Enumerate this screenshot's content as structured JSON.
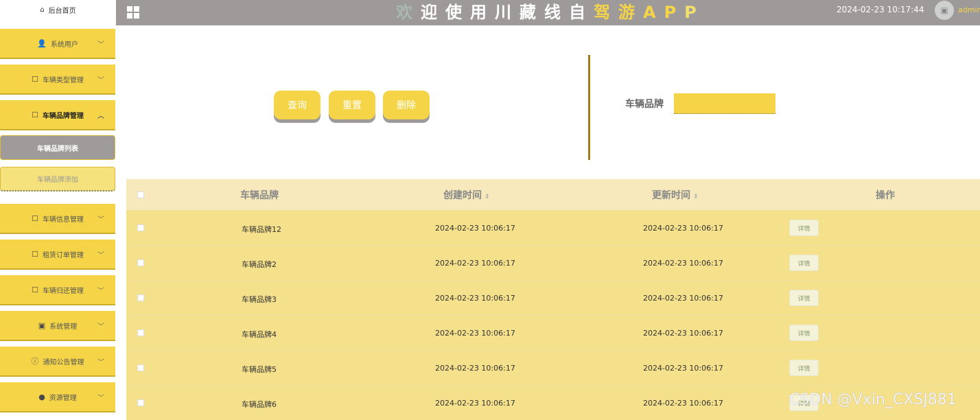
{
  "sidebar": {
    "home_label": "后台首页",
    "items": [
      {
        "label": "系统用户",
        "icon": "user-icon"
      },
      {
        "label": "车辆类型管理",
        "icon": "edit-icon"
      },
      {
        "label": "车辆品牌管理",
        "icon": "edit-icon"
      },
      {
        "label": "车辆信息管理",
        "icon": "edit-icon"
      },
      {
        "label": "租赁订单管理",
        "icon": "edit-icon"
      },
      {
        "label": "车辆归还管理",
        "icon": "edit-icon"
      },
      {
        "label": "系统管理",
        "icon": "image-icon"
      },
      {
        "label": "通知公告管理",
        "icon": "info-icon"
      },
      {
        "label": "资源管理",
        "icon": "location-icon"
      }
    ],
    "sub_items": [
      {
        "label": "车辆品牌列表"
      },
      {
        "label": "车辆品牌添加"
      }
    ]
  },
  "header": {
    "title_chars": [
      "欢",
      "迎",
      "使",
      "用",
      "川",
      "藏",
      "线",
      "自",
      "驾",
      "游",
      "A",
      "P",
      "P"
    ],
    "title_colors": [
      "#a9b9b2",
      "#ffffff",
      "#ffffff",
      "#ffffff",
      "#ffffff",
      "#ffffff",
      "#ffffff",
      "#ffffff",
      "#f5d547",
      "#f5d547",
      "#f5d547",
      "#f5d547",
      "#f3df6e"
    ],
    "datetime": "2024-02-23 10:17:44",
    "user": "admin"
  },
  "toolbar": {
    "query_label": "查询",
    "reset_label": "重置",
    "delete_label": "删除",
    "search_label": "车辆品牌",
    "search_value": ""
  },
  "table": {
    "headers": {
      "brand": "车辆品牌",
      "created": "创建时间",
      "updated": "更新时间",
      "actions": "操作"
    },
    "sort_glyph": "⇕",
    "detail_label": "详情",
    "rows": [
      {
        "brand": "车辆品牌12",
        "created": "2024-02-23 10:06:17",
        "updated": "2024-02-23 10:06:17"
      },
      {
        "brand": "车辆品牌2",
        "created": "2024-02-23 10:06:17",
        "updated": "2024-02-23 10:06:17"
      },
      {
        "brand": "车辆品牌3",
        "created": "2024-02-23 10:06:17",
        "updated": "2024-02-23 10:06:17"
      },
      {
        "brand": "车辆品牌4",
        "created": "2024-02-23 10:06:17",
        "updated": "2024-02-23 10:06:17"
      },
      {
        "brand": "车辆品牌5",
        "created": "2024-02-23 10:06:17",
        "updated": "2024-02-23 10:06:17"
      },
      {
        "brand": "车辆品牌6",
        "created": "2024-02-23 10:06:17",
        "updated": "2024-02-23 10:06:17"
      }
    ]
  },
  "watermark": "CSDN @Vxin_CXSJ881",
  "colors": {
    "accent": "#f5d547",
    "header_bg": "#9e9a9a",
    "row_bg": "#f5e08c"
  }
}
